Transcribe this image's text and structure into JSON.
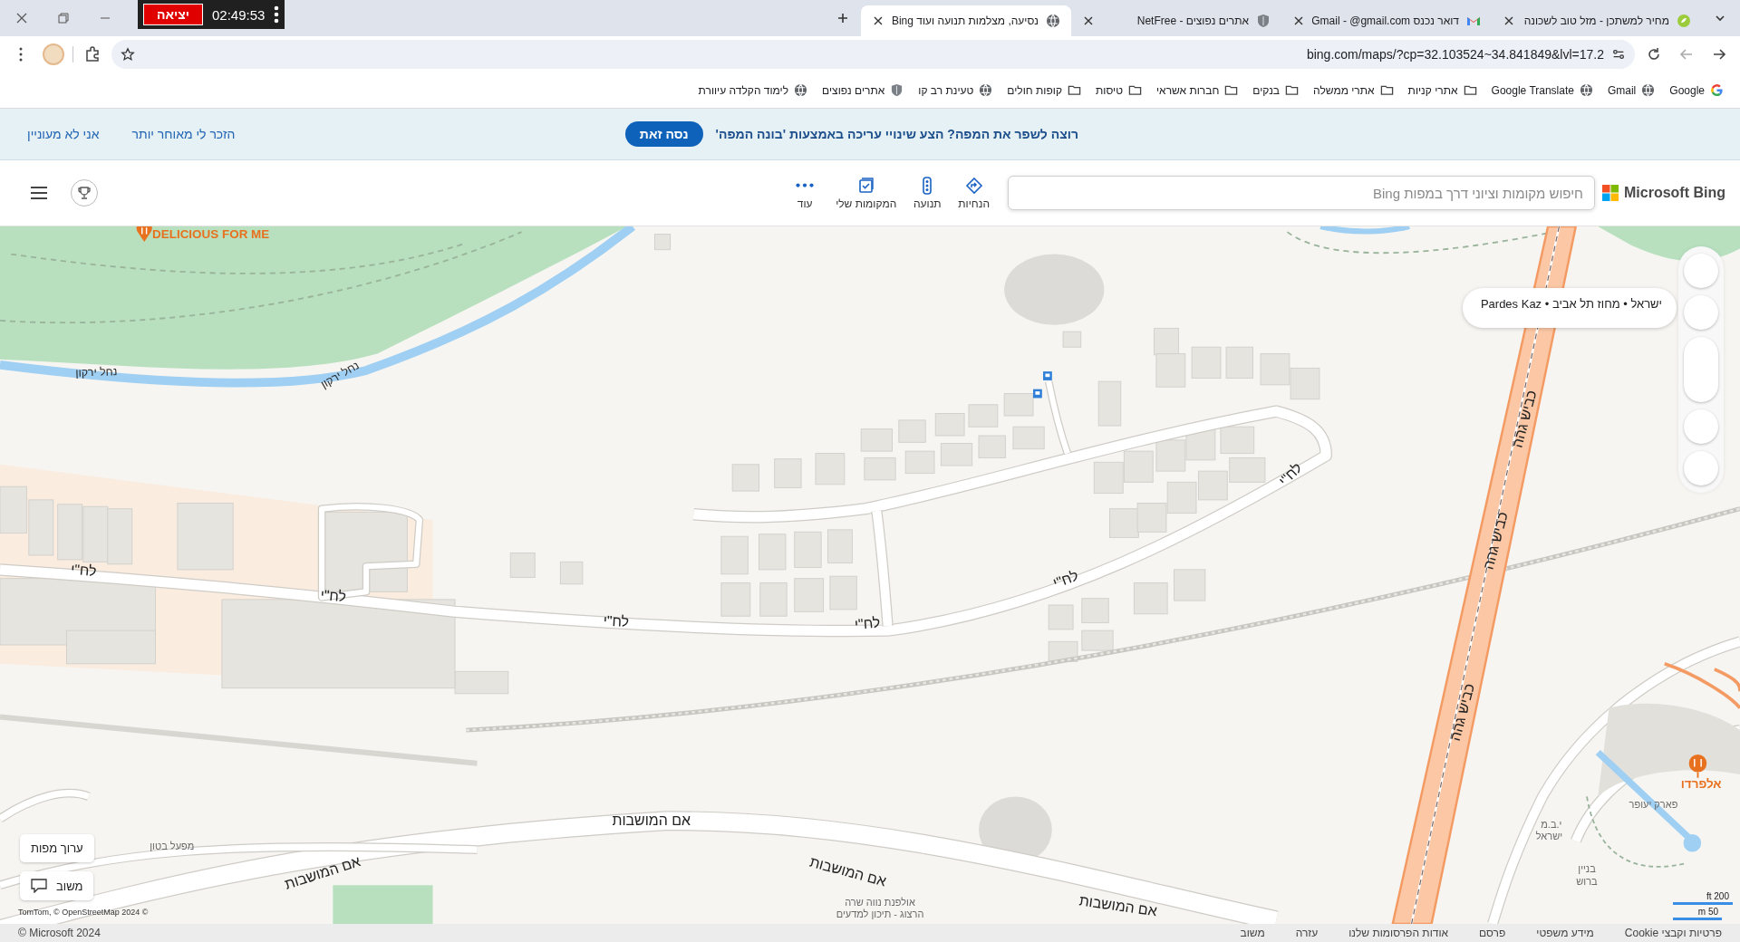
{
  "timer": {
    "exit_button": "יציאה",
    "time": "02:49:53"
  },
  "tabs": [
    {
      "title": "מחיר למשתכן - מזל טוב לשכונה",
      "kind": "leaf",
      "selected": false
    },
    {
      "title": "דואר נכנס Gmail - ‎@gmail.com",
      "kind": "mail",
      "selected": false
    },
    {
      "title": "אתרים נפוצים - NetFree",
      "kind": "shield",
      "selected": false
    },
    {
      "title": "נסיעה, מצלמות תנועה ועוד Bing",
      "kind": "globe",
      "selected": true
    }
  ],
  "address_bar": {
    "url": "bing.com/maps/?cp=32.103524~34.841849&lvl=17.2"
  },
  "bookmarks": [
    {
      "label": "Google",
      "kind": "google"
    },
    {
      "label": "Gmail",
      "kind": "globe"
    },
    {
      "label": "Google Translate",
      "kind": "globe"
    },
    {
      "label": "אתרי קניות",
      "kind": "folder"
    },
    {
      "label": "אתרי ממשלה",
      "kind": "folder"
    },
    {
      "label": "בנקים",
      "kind": "folder"
    },
    {
      "label": "חברות אשראי",
      "kind": "folder"
    },
    {
      "label": "טיסות",
      "kind": "folder"
    },
    {
      "label": "קופות חולים",
      "kind": "folder"
    },
    {
      "label": "טעינת רב קו",
      "kind": "globe"
    },
    {
      "label": "אתרים נפוצים",
      "kind": "shield"
    },
    {
      "label": "לימוד הקלדה עיוורת",
      "kind": "globe"
    }
  ],
  "banner": {
    "message": "רוצה לשפר את המפה? הצע שינויי עריכה באמצעות 'בונה המפה'",
    "button": "נסה זאת",
    "remind_link": "הזכר לי מאוחר יותר",
    "dismiss_link": "אני לא מעוניין"
  },
  "header": {
    "logo": "Microsoft Bing",
    "search": {
      "placeholder": "חיפוש מקומות וציוני דרך במפות Bing"
    },
    "nav": [
      {
        "label": "הנחיות",
        "kind": "directions"
      },
      {
        "label": "תנועה",
        "kind": "traffic"
      },
      {
        "label": "המקומות שלי",
        "kind": "places"
      },
      {
        "label": "עוד",
        "kind": "more"
      }
    ]
  },
  "map": {
    "location_card": "ישראל • מחוז תל אביב • Pardes Kaz",
    "labels": [
      {
        "text": "DELICIOUS FOR ME",
        "kind": "poi"
      },
      {
        "text": "נחל ירקון",
        "kind": "water"
      },
      {
        "text": "נחל ירקון",
        "kind": "water"
      },
      {
        "text": "לח\"י",
        "kind": "road"
      },
      {
        "text": "לח\"י",
        "kind": "road"
      },
      {
        "text": "לח\"י",
        "kind": "road"
      },
      {
        "text": "לח\"י",
        "kind": "road"
      },
      {
        "text": "לח\"י",
        "kind": "road"
      },
      {
        "text": "לח\"י",
        "kind": "road"
      },
      {
        "text": "כביש גהה",
        "kind": "road"
      },
      {
        "text": "כביש גהה",
        "kind": "road"
      },
      {
        "text": "כביש גהה",
        "kind": "road"
      },
      {
        "text": "אם המושבות",
        "kind": "road"
      },
      {
        "text": "אם המושבות",
        "kind": "road"
      },
      {
        "text": "אם המושבות",
        "kind": "road"
      },
      {
        "text": "אם המושבות",
        "kind": "road"
      },
      {
        "text": "מפעל בטון",
        "kind": "place"
      },
      {
        "text": "אולפנת נווה שרה",
        "kind": "place"
      },
      {
        "text": "הרצוג - תיכון למדעים",
        "kind": "place"
      },
      {
        "text": "פארק יעופר",
        "kind": "place"
      },
      {
        "text": "י.ב.מ",
        "kind": "place"
      },
      {
        "text": "ישראל",
        "kind": "place"
      },
      {
        "text": "בניין",
        "kind": "place"
      },
      {
        "text": "ברוש",
        "kind": "place"
      },
      {
        "text": "אלפרדו",
        "kind": "poi"
      }
    ],
    "edit_button": "ערוך מפות",
    "feedback_button": "משוב",
    "attribution": "TomTom, © OpenStreetMap  2024 ©",
    "scale": [
      "200 ft",
      "50 m"
    ]
  },
  "footer": {
    "copyright": "Microsoft 2024 ©",
    "links": [
      "פרטיות וקבצי Cookie",
      "מידע משפטי",
      "פרסם",
      "אודות הפרסומות שלנו",
      "עזרה",
      "משוב"
    ]
  }
}
